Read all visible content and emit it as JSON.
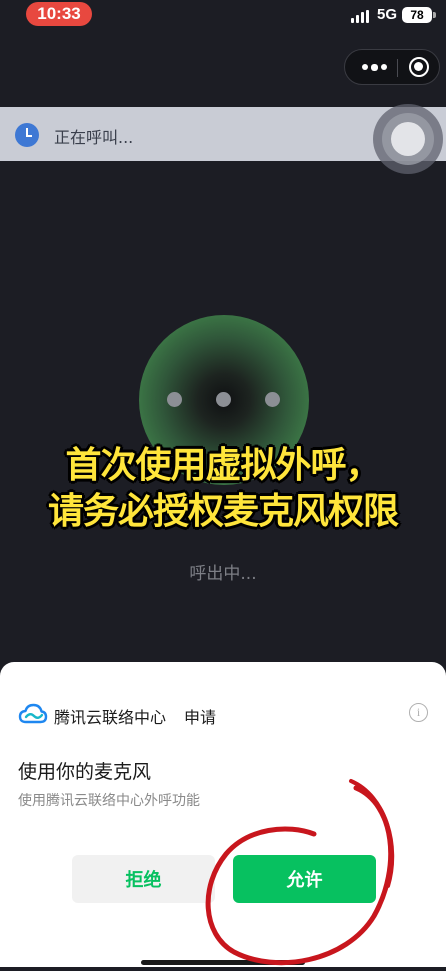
{
  "status_bar": {
    "time": "10:33",
    "network": "5G",
    "battery": "78"
  },
  "call_banner": {
    "text": "正在呼叫..."
  },
  "caption": {
    "line1": "首次使用虚拟外呼，",
    "line2": "请务必授权麦克风权限"
  },
  "call_status": "呼出中...",
  "permission_sheet": {
    "app_name": "腾讯云联络中心",
    "request_label": "申请",
    "title": "使用你的麦克风",
    "description": "使用腾讯云联络中心外呼功能",
    "deny_label": "拒绝",
    "allow_label": "允许"
  },
  "colors": {
    "accent_green": "#07c160",
    "caption_yellow": "#ffe53b",
    "annotation_red": "#c8161d",
    "time_pill": "#e8483f"
  },
  "icons": [
    "signal-icon",
    "battery-icon",
    "more-icon",
    "target-icon",
    "clock-icon",
    "cloud-icon",
    "info-icon"
  ]
}
